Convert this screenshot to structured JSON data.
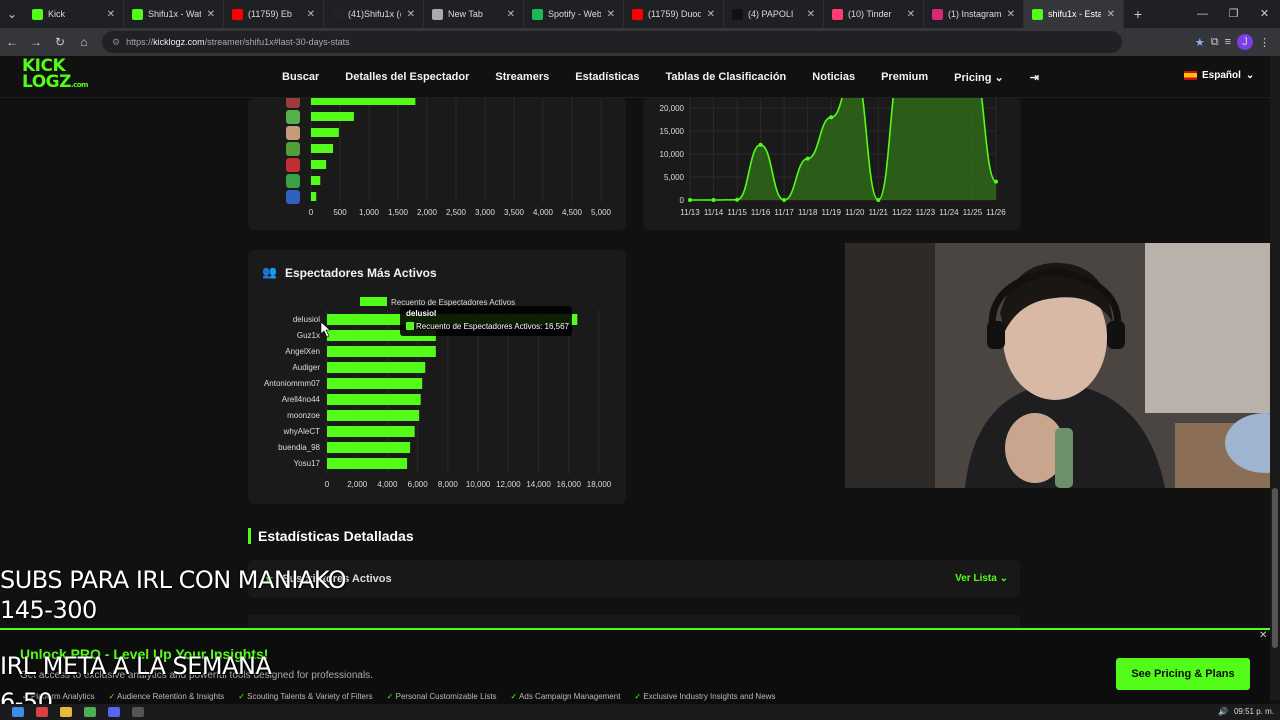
{
  "browser": {
    "tabs": [
      {
        "title": "Kick",
        "color": "#53fc18"
      },
      {
        "title": "Shifu1x - Watch",
        "color": "#53fc18"
      },
      {
        "title": "(11759) Eb",
        "color": "#ff0000"
      },
      {
        "title": "(41)Shifu1x (@",
        "color": "#222222"
      },
      {
        "title": "New Tab",
        "color": "#aaaaaa"
      },
      {
        "title": "Spotify - Web",
        "color": "#1db954"
      },
      {
        "title": "(11759) Duode",
        "color": "#ff0000"
      },
      {
        "title": "(4) PAPOLI",
        "color": "#111111"
      },
      {
        "title": "(10) Tinder",
        "color": "#fe3c72"
      },
      {
        "title": "(1) Instagram",
        "color": "#d62976"
      },
      {
        "title": "shifu1x - Estad",
        "color": "#53fc18",
        "active": true
      }
    ],
    "url_prefix": "https://",
    "url_domain": "kicklogz.com",
    "url_path": "/streamer/shifu1x#last-30-days-stats"
  },
  "site": {
    "logo_line1": "KICK",
    "logo_line2": "LOGZ",
    "logo_suffix": ".com",
    "nav": [
      "Buscar",
      "Detalles del Espectador",
      "Streamers",
      "Estadísticas",
      "Tablas de Clasificación",
      "Noticias",
      "Premium",
      "Pricing"
    ],
    "language": "Español"
  },
  "top_bar_chart": {
    "x_ticks": [
      "0",
      "500",
      "1,000",
      "1,500",
      "2,000",
      "2,500",
      "3,000",
      "3,500",
      "4,000",
      "4,500",
      "5,000"
    ],
    "values": [
      1800,
      740,
      480,
      380,
      260,
      160,
      90
    ]
  },
  "top_line_chart": {
    "y_ticks": [
      "0",
      "5,000",
      "10,000",
      "15,000",
      "20,000"
    ],
    "x_ticks": [
      "11/13",
      "11/14",
      "11/15",
      "11/16",
      "11/17",
      "11/18",
      "11/19",
      "11/20",
      "11/21",
      "11/22",
      "11/23",
      "11/24",
      "11/25",
      "11/26"
    ]
  },
  "active_viewers": {
    "title": "Espectadores Más Activos",
    "chart_data": {
      "type": "bar",
      "orientation": "horizontal",
      "legend": "Recuento de Espectadores Activos",
      "categories": [
        "delusiol",
        "Guz1x",
        "AngelXen",
        "Audiger",
        "Antoniommm07",
        "Arell4no44",
        "moonzoe",
        "whyAleCT",
        "buendia_98",
        "Yosu17"
      ],
      "values": [
        16567,
        7200,
        7200,
        6500,
        6300,
        6200,
        6100,
        5800,
        5500,
        5300
      ],
      "xlim": [
        0,
        18000
      ],
      "x_ticks": [
        "0",
        "2,000",
        "4,000",
        "6,000",
        "8,000",
        "10,000",
        "12,000",
        "14,000",
        "16,000",
        "18,000"
      ],
      "tooltip_title": "delusiol",
      "tooltip_text": "Recuento de Espectadores Activos: 16,567"
    }
  },
  "detailed": {
    "title": "Estadísticas Detalladas",
    "subs_label": "Suscriptores Activos",
    "ver_lista": "Ver Lista"
  },
  "promo": {
    "title": "Unlock PRO - Level Up Your Insights!",
    "subtitle": "Get access to exclusive analytics and powerful tools designed for professionals.",
    "features": [
      "Platform Analytics",
      "Audience Retention & Insights",
      "Scouting Talents & Variety of Filters",
      "Personal Customizable Lists",
      "Ads Campaign Management",
      "Exclusive Industry Insights and News"
    ],
    "button": "See Pricing & Plans"
  },
  "overlay": {
    "line1": "SUBS PARA IRL CON MANIAKO",
    "line2": "145-300",
    "line3": "IRL META A LA SEMANA",
    "line4": "6-50"
  },
  "taskbar": {
    "time": "09:51 p. m."
  }
}
